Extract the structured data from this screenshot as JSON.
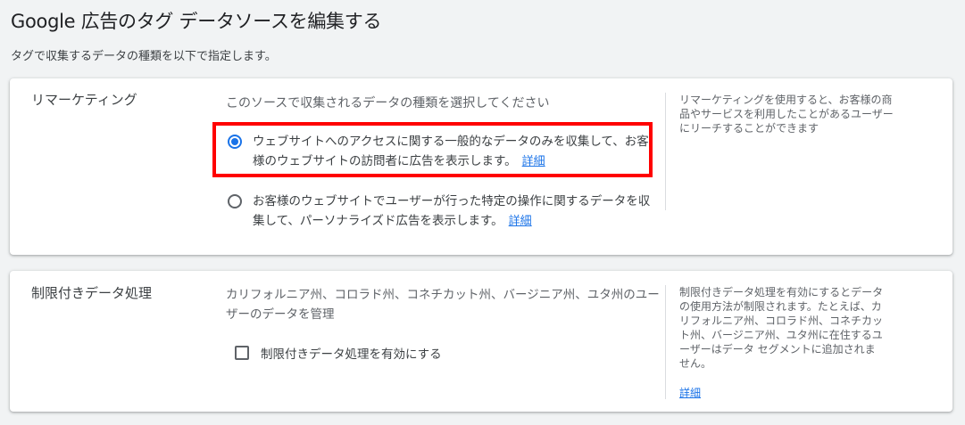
{
  "page": {
    "title": "Google 広告のタグ データソースを編集する",
    "subtitle": "タグで収集するデータの種類を以下で指定します。"
  },
  "remarketing": {
    "title": "リマーケティング",
    "prompt": "このソースで収集されるデータの種類を選択してください",
    "options": [
      {
        "label": "ウェブサイトへのアクセスに関する一般的なデータのみを収集して、お客様のウェブサイトの訪問者に広告を表示します。",
        "link": "詳細",
        "selected": true
      },
      {
        "label": "お客様のウェブサイトでユーザーが行った特定の操作に関するデータを収集して、パーソナライズド広告を表示します。",
        "link": "詳細",
        "selected": false
      }
    ],
    "help": "リマーケティングを使用すると、お客様の商品やサービスを利用したことがあるユーザーにリーチすることができます"
  },
  "restricted": {
    "title": "制限付きデータ処理",
    "description": "カリフォルニア州、コロラド州、コネチカット州、バージニア州、ユタ州のユーザーのデータを管理",
    "checkbox_label": "制限付きデータ処理を有効にする",
    "checkbox_checked": false,
    "help": "制限付きデータ処理を有効にするとデータの使用方法が制限されます。たとえば、カリフォルニア州、コロラド州、コネチカット州、バージニア州、ユタ州に在住するユーザーはデータ セグメントに追加されません。",
    "help_link": "詳細"
  },
  "colors": {
    "accent": "#1a73e8",
    "highlight": "#ff0000"
  }
}
